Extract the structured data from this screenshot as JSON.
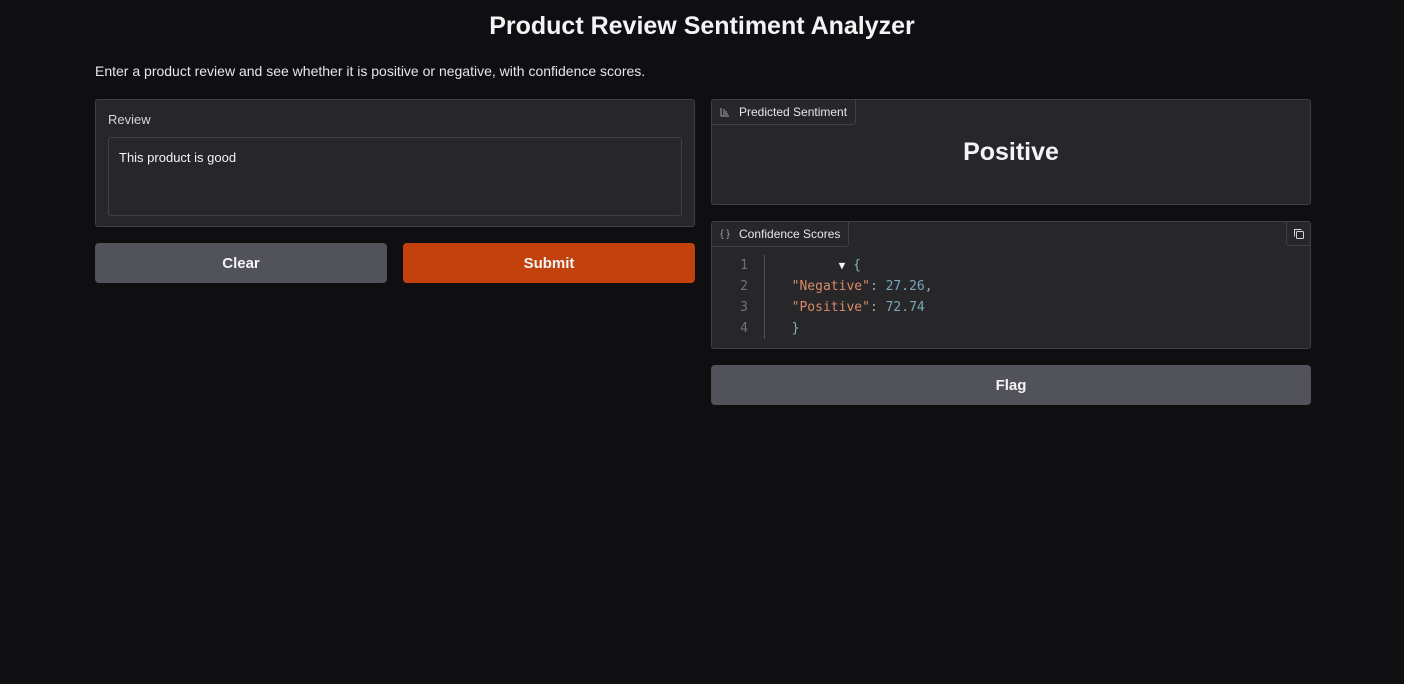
{
  "app": {
    "title": "Product Review Sentiment Analyzer",
    "description": "Enter a product review and see whether it is positive or negative, with confidence scores."
  },
  "input": {
    "label": "Review",
    "value": "This product is good"
  },
  "buttons": {
    "clear": "Clear",
    "submit": "Submit",
    "flag": "Flag"
  },
  "output_sentiment": {
    "label": "Predicted Sentiment",
    "value": "Positive",
    "icon": "label-icon"
  },
  "output_confidence": {
    "label": "Confidence Scores",
    "icon": "json-braces-icon",
    "line_numbers": [
      "1",
      "2",
      "3",
      "4"
    ],
    "open_brace": "{",
    "close_brace": "}",
    "entries": [
      {
        "key": "\"Negative\"",
        "value": "27.26",
        "trail": ","
      },
      {
        "key": "\"Positive\"",
        "value": "72.74",
        "trail": ""
      }
    ]
  },
  "colors": {
    "background": "#0f0f11",
    "panel": "#27272a",
    "primary_button": "#c2410c",
    "secondary_button": "#52525b"
  }
}
